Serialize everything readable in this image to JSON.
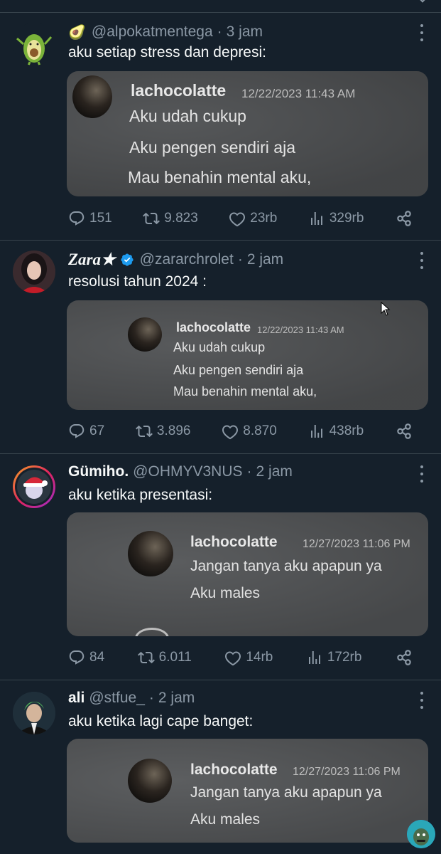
{
  "icons": {
    "reply": "reply-icon",
    "retweet": "retweet-icon",
    "like": "heart-icon",
    "views": "analytics-icon",
    "share": "share-icon",
    "more": "more-icon",
    "verified": "verified-badge-icon"
  },
  "colors": {
    "background": "#15202b",
    "muted": "#8b98a5",
    "text": "#f7f9f9",
    "accent": "#1d9bf0",
    "divider": "#38444d"
  },
  "tweets": [
    {
      "display_name": "",
      "name_emoji": "🥑",
      "handle": "@alpokatmentega",
      "time": "3 jam",
      "text": "aku setiap stress dan depresi:",
      "media": {
        "name": "lachocolatte",
        "date": "12/22/2023 11:43 AM",
        "lines": [
          "Aku udah cukup",
          "Aku pengen sendiri aja",
          "Mau benahin mental aku,"
        ]
      },
      "replies": "151",
      "retweets": "9.823",
      "likes": "23rb",
      "views": "329rb"
    },
    {
      "display_name": "Zara★",
      "handle": "@zararchrolet",
      "time": "2 jam",
      "text": "resolusi tahun 2024 :",
      "media": {
        "name": "lachocolatte",
        "date": "12/22/2023 11:43 AM",
        "lines": [
          "Aku udah cukup",
          "Aku pengen sendiri aja",
          "Mau benahin mental aku,"
        ]
      },
      "replies": "67",
      "retweets": "3.896",
      "likes": "8.870",
      "views": "438rb"
    },
    {
      "display_name": "Gümiho.",
      "handle": "@OHMYV3NUS",
      "time": "2 jam",
      "text": "aku ketika presentasi:",
      "media": {
        "name": "lachocolatte",
        "date": "12/27/2023 11:06 PM",
        "lines": [
          "Jangan tanya aku apapun ya",
          "Aku males"
        ]
      },
      "replies": "84",
      "retweets": "6.011",
      "likes": "14rb",
      "views": "172rb"
    },
    {
      "display_name": "ali",
      "handle": "@stfue_",
      "time": "2 jam",
      "text": "aku ketika lagi cape banget:",
      "media": {
        "name": "lachocolatte",
        "date": "12/27/2023 11:06 PM",
        "lines": [
          "Jangan tanya aku apapun ya",
          "Aku males"
        ]
      }
    }
  ],
  "separator": "·"
}
